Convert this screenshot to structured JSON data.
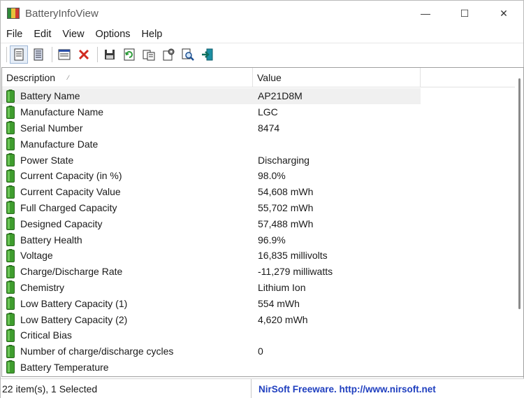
{
  "window": {
    "title": "BatteryInfoView",
    "controls": {
      "minimize": "—",
      "maximize": "☐",
      "close": "✕"
    }
  },
  "menu": [
    "File",
    "Edit",
    "View",
    "Options",
    "Help"
  ],
  "toolbar": {
    "icons": [
      "properties-icon",
      "list-icon",
      "html-report-icon",
      "delete-icon",
      "save-icon",
      "refresh-icon",
      "copy-icon",
      "options-icon",
      "find-icon",
      "exit-icon"
    ]
  },
  "listview": {
    "columns": {
      "description": "Description",
      "value": "Value",
      "sort_indicator": "⁄"
    },
    "rows": [
      {
        "description": "Battery Name",
        "value": "AP21D8M"
      },
      {
        "description": "Manufacture Name",
        "value": "LGC"
      },
      {
        "description": "Serial Number",
        "value": "8474"
      },
      {
        "description": "Manufacture Date",
        "value": ""
      },
      {
        "description": "Power State",
        "value": "Discharging"
      },
      {
        "description": "Current Capacity (in %)",
        "value": "98.0%"
      },
      {
        "description": "Current Capacity Value",
        "value": "54,608 mWh"
      },
      {
        "description": "Full Charged Capacity",
        "value": "55,702 mWh"
      },
      {
        "description": "Designed Capacity",
        "value": "57,488 mWh"
      },
      {
        "description": "Battery Health",
        "value": "96.9%"
      },
      {
        "description": "Voltage",
        "value": "16,835 millivolts"
      },
      {
        "description": "Charge/Discharge Rate",
        "value": "-11,279 milliwatts"
      },
      {
        "description": "Chemistry",
        "value": "Lithium Ion"
      },
      {
        "description": "Low Battery Capacity (1)",
        "value": "554 mWh"
      },
      {
        "description": "Low Battery Capacity (2)",
        "value": "4,620 mWh"
      },
      {
        "description": "Critical Bias",
        "value": ""
      },
      {
        "description": "Number of charge/discharge cycles",
        "value": "0"
      },
      {
        "description": "Battery Temperature",
        "value": ""
      }
    ]
  },
  "statusbar": {
    "items_text": "22 item(s), 1 Selected",
    "credit": "NirSoft Freeware.  http://www.nirsoft.net"
  },
  "colors": {
    "battery_green": "#3f9d2e",
    "link_blue": "#1f3fbf",
    "selection": "#f0f0f0"
  }
}
